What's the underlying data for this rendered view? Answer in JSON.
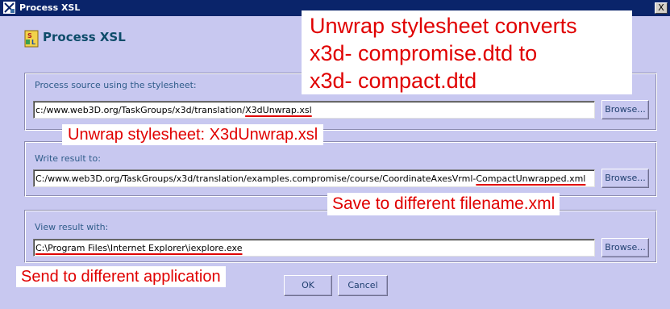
{
  "window": {
    "title": "Process XSL",
    "close_label": "X"
  },
  "header": {
    "title": "Process XSL"
  },
  "source_group": {
    "label": "Process source using the stylesheet:",
    "path_prefix": "c:/www.web3D.org/TaskGroups/x3d/translation/",
    "path_highlight": "X3dUnwrap.xsl",
    "browse_label": "Browse..."
  },
  "result_group": {
    "label": "Write result to:",
    "path_prefix": "C:/www.web3D.org/TaskGroups/x3d/translation/examples.compromise/course/CoordinateAxesVrml-",
    "path_highlight": "CompactUnwrapped.xml",
    "browse_label": "Browse..."
  },
  "view_group": {
    "label": "View result with:",
    "path_value": "C:\\Program Files\\Internet Explorer\\iexplore.exe",
    "browse_label": "Browse..."
  },
  "buttons": {
    "ok_label": "OK",
    "cancel_label": "Cancel"
  },
  "annotations": {
    "main_line1": "Unwrap stylesheet converts",
    "main_line2": "x3d- compromise.dtd to",
    "main_line3": "x3d- compact.dtd",
    "stylesheet_note": "Unwrap stylesheet:  X3dUnwrap.xsl",
    "filename_note": "Save to different filename.xml",
    "application_note": "Send to different application"
  },
  "colors": {
    "window_bg": "#c8c8f0",
    "titlebar_bg": "#0a246a",
    "annotation_red": "#e00000",
    "label_blue": "#2f5c8a"
  },
  "icons": {
    "titlebar": "app-icon",
    "header": "xsl-document-icon"
  }
}
